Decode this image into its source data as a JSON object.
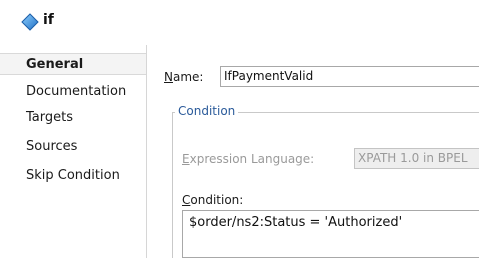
{
  "header": {
    "title": "if",
    "icon": "diamond-activity-icon"
  },
  "sidebar": {
    "items": [
      {
        "label": "General",
        "selected": true
      },
      {
        "label": "Documentation",
        "selected": false
      },
      {
        "label": "Targets",
        "selected": false
      },
      {
        "label": "Sources",
        "selected": false
      },
      {
        "label": "Skip Condition",
        "selected": false
      }
    ]
  },
  "form": {
    "name_label_accel": "N",
    "name_label_rest": "ame:",
    "name_value": "IfPaymentValid",
    "condition_group_title": "Condition",
    "expression_language_accel": "E",
    "expression_language_rest": "xpression Language:",
    "expression_language_value": "XPATH 1.0 in BPEL",
    "condition_label_accel": "C",
    "condition_label_rest": "ondition:",
    "condition_value": "$order/ns2:Status = 'Authorized'"
  },
  "colors": {
    "accent": "#2a5a9a",
    "icon_blue": "#3a86d6"
  }
}
